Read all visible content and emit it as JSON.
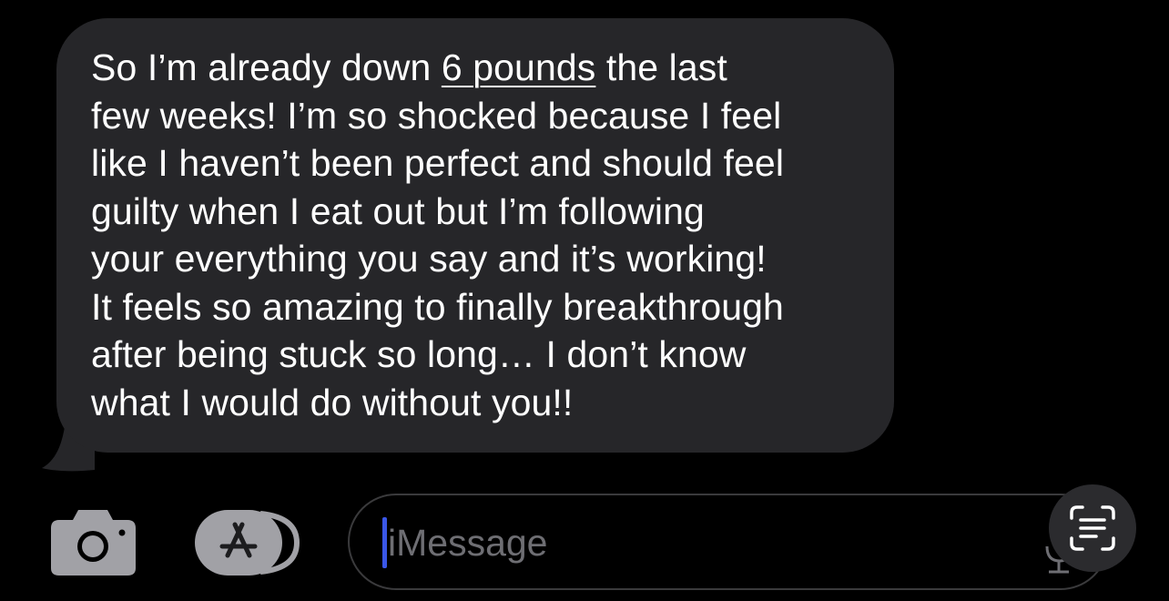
{
  "conversation": {
    "incoming_message": {
      "lines": [
        {
          "before": "So I’m already down ",
          "link": "6 pounds",
          "after": " the last"
        },
        {
          "text": "few weeks! I’m so shocked because I feel"
        },
        {
          "text": "like I haven’t been perfect and should feel"
        },
        {
          "text": "guilty when I eat out but I’m following"
        },
        {
          "text": "your everything you say and it’s working!"
        },
        {
          "text": "It feels so amazing to finally breakthrough"
        },
        {
          "text": "after being stuck so long… I don’t know"
        },
        {
          "text": "what I would do without you!!"
        }
      ],
      "bubble_color": "#262629"
    }
  },
  "composer": {
    "camera_icon": "camera-icon",
    "apps_icon": "app-store-icon",
    "message_placeholder": "iMessage",
    "live_text_icon": "live-text-scan-icon",
    "cursor_color": "#3a57e8"
  }
}
